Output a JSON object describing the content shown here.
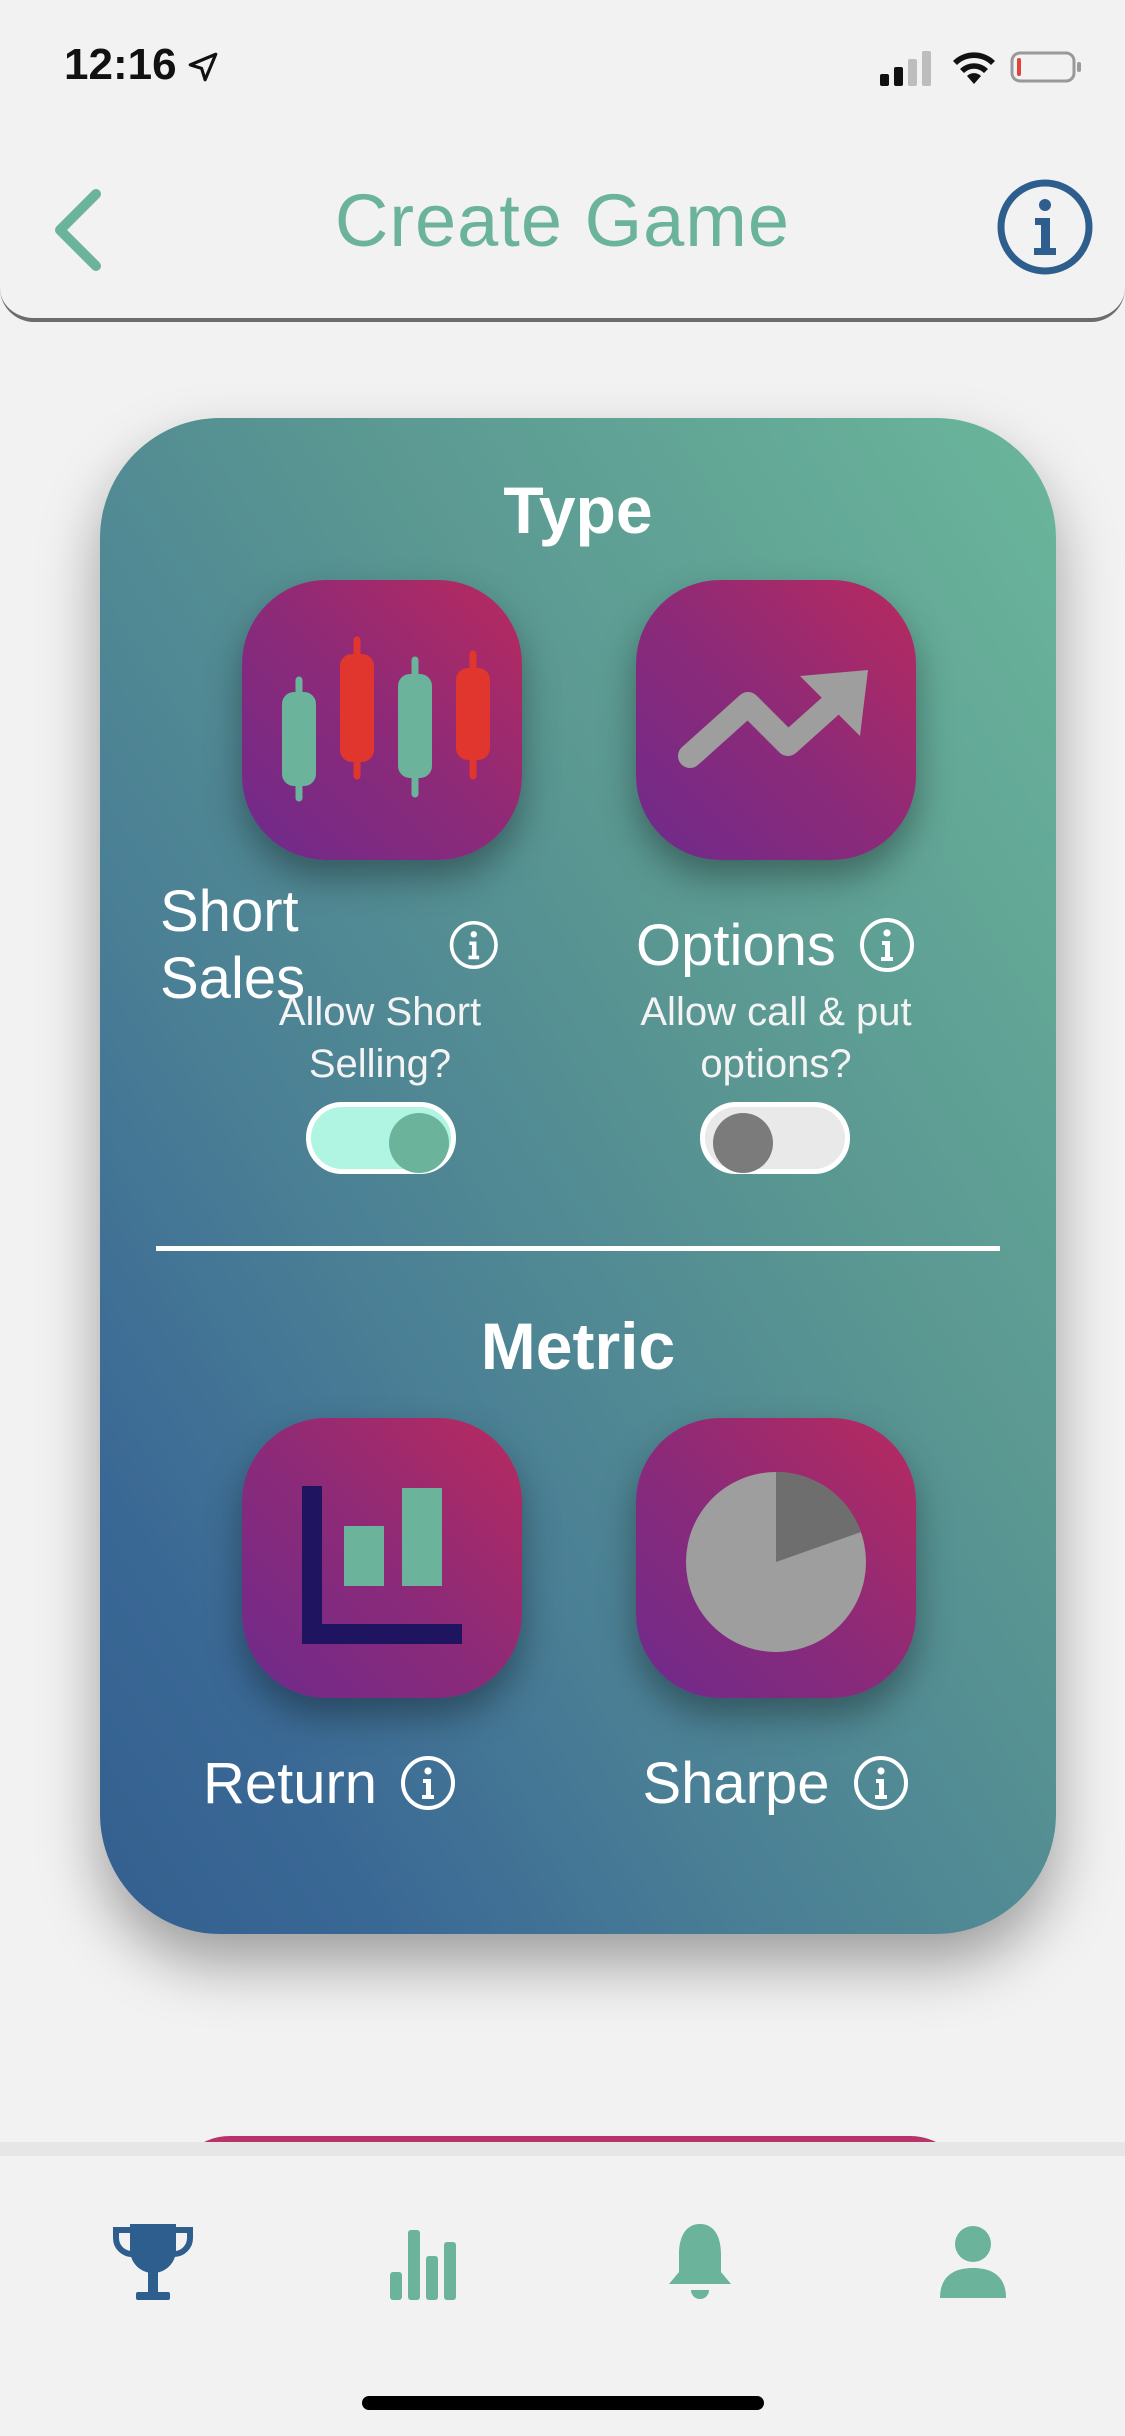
{
  "status_bar": {
    "time": "12:16",
    "icons": [
      "location-arrow-icon",
      "cellular-signal-icon",
      "wifi-icon",
      "battery-low-icon"
    ]
  },
  "header": {
    "title": "Create Game",
    "back_icon": "chevron-left-icon",
    "info_icon": "info-circle-icon"
  },
  "type_section": {
    "title": "Type",
    "options": [
      {
        "label": "Short Sales",
        "description_line1": "Allow Short",
        "description_line2": "Selling?",
        "icon": "candlestick-chart-icon",
        "enabled": true
      },
      {
        "label": "Options",
        "description_line1": "Allow call & put",
        "description_line2": "options?",
        "icon": "trending-up-arrow-icon",
        "enabled": false
      }
    ]
  },
  "metric_section": {
    "title": "Metric",
    "options": [
      {
        "label": "Return",
        "icon": "bar-chart-icon"
      },
      {
        "label": "Sharpe",
        "icon": "pie-chart-icon"
      }
    ]
  },
  "tab_bar": {
    "items": [
      {
        "icon": "trophy-icon",
        "active": true
      },
      {
        "icon": "bar-chart-icon",
        "active": false
      },
      {
        "icon": "bell-icon",
        "active": false
      },
      {
        "icon": "user-icon",
        "active": false
      }
    ]
  },
  "colors": {
    "accent_green": "#6bb39a",
    "accent_blue": "#2e5e8e",
    "tile_gradient_start": "#6e2a8c",
    "tile_gradient_end": "#b82a5e",
    "toggle_on_track": "#b0f5e1",
    "toggle_off_track": "#e9e9e9"
  }
}
